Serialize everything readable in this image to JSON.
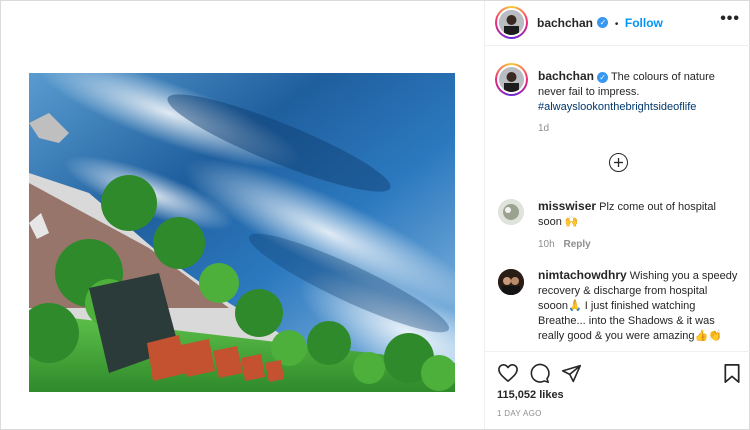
{
  "post": {
    "username": "bachchan",
    "follow_label": "Follow",
    "separator": "•",
    "more_label": "•••",
    "caption_text": "The colours of nature never fail to impress.",
    "caption_hashtag": "#alwayslookonthebrightsideoflife",
    "caption_age": "1d",
    "likes": "115,052 likes",
    "date": "1 DAY AGO"
  },
  "comments": [
    {
      "username": "misswiser",
      "text": "Plz come out of hospital soon 🙌",
      "age": "10h",
      "reply_label": "Reply"
    },
    {
      "username": "nimtachowdhry",
      "text": "Wishing you a speedy recovery & discharge from hospital sooon🙏 I just finished watching Breathe... into the Shadows & it was really good & you were amazing👍👏"
    }
  ],
  "icons": {
    "verified": "verified-badge-icon",
    "load_more": "plus-circle-icon",
    "like": "heart-icon",
    "comment": "comment-bubble-icon",
    "share": "paper-plane-icon",
    "save": "bookmark-icon"
  },
  "colors": {
    "link_blue": "#0095f6",
    "hashtag": "#00376b",
    "muted": "#8e8e8e",
    "verified": "#3897f0"
  }
}
